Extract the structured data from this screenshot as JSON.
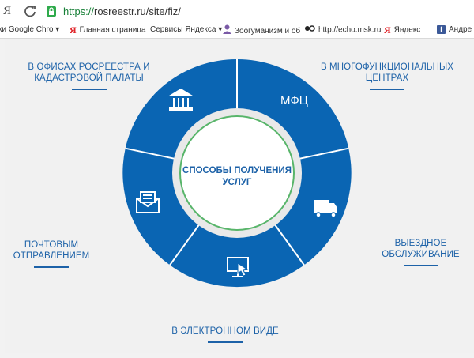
{
  "browser": {
    "yandex_glyph": "Я",
    "reload_icon": "reload-icon",
    "url_scheme": "https://",
    "url_rest": "rosreestr.ru/site/fiz/",
    "bookmarks": [
      {
        "label": "ки Google Chro",
        "has_dropdown": true
      },
      {
        "label": "Главная страница",
        "icon": "yandex-icon",
        "has_dropdown": false
      },
      {
        "label": "Сервисы Яндекса",
        "has_dropdown": true
      },
      {
        "label": "Зоогуманизм и об",
        "icon": "user-icon",
        "has_dropdown": false
      },
      {
        "label": "http://echo.msk.ru",
        "icon": "echo-icon",
        "has_dropdown": false
      },
      {
        "label": "Яндекс",
        "icon": "yandex-icon",
        "has_dropdown": false
      },
      {
        "label": "Андре",
        "icon": "facebook-icon",
        "has_dropdown": false
      }
    ]
  },
  "diagram": {
    "center_title": "СПОСОБЫ ПОЛУЧЕНИЯ УСЛУГ",
    "mfc_segment_label": "МФЦ",
    "labels": {
      "offices": "В ОФИСАХ РОСРЕЕСТРА И КАДАСТРОВОЙ ПАЛАТЫ",
      "mfc": "В МНОГОФУНКЦИОНАЛЬНЫХ ЦЕНТРАХ",
      "mobile": "ВЫЕЗДНОЕ ОБСЛУЖИВАНИЕ",
      "electronic": "В ЭЛЕКТРОННОМ ВИДЕ",
      "post": "ПОЧТОВЫМ ОТПРАВЛЕНИЕМ"
    },
    "colors": {
      "segment": "#0a65b3",
      "separator": "#ffffff",
      "inner_ring": "#e9e9e9",
      "center_border": "#58b56a",
      "text": "#1d62a8"
    }
  }
}
